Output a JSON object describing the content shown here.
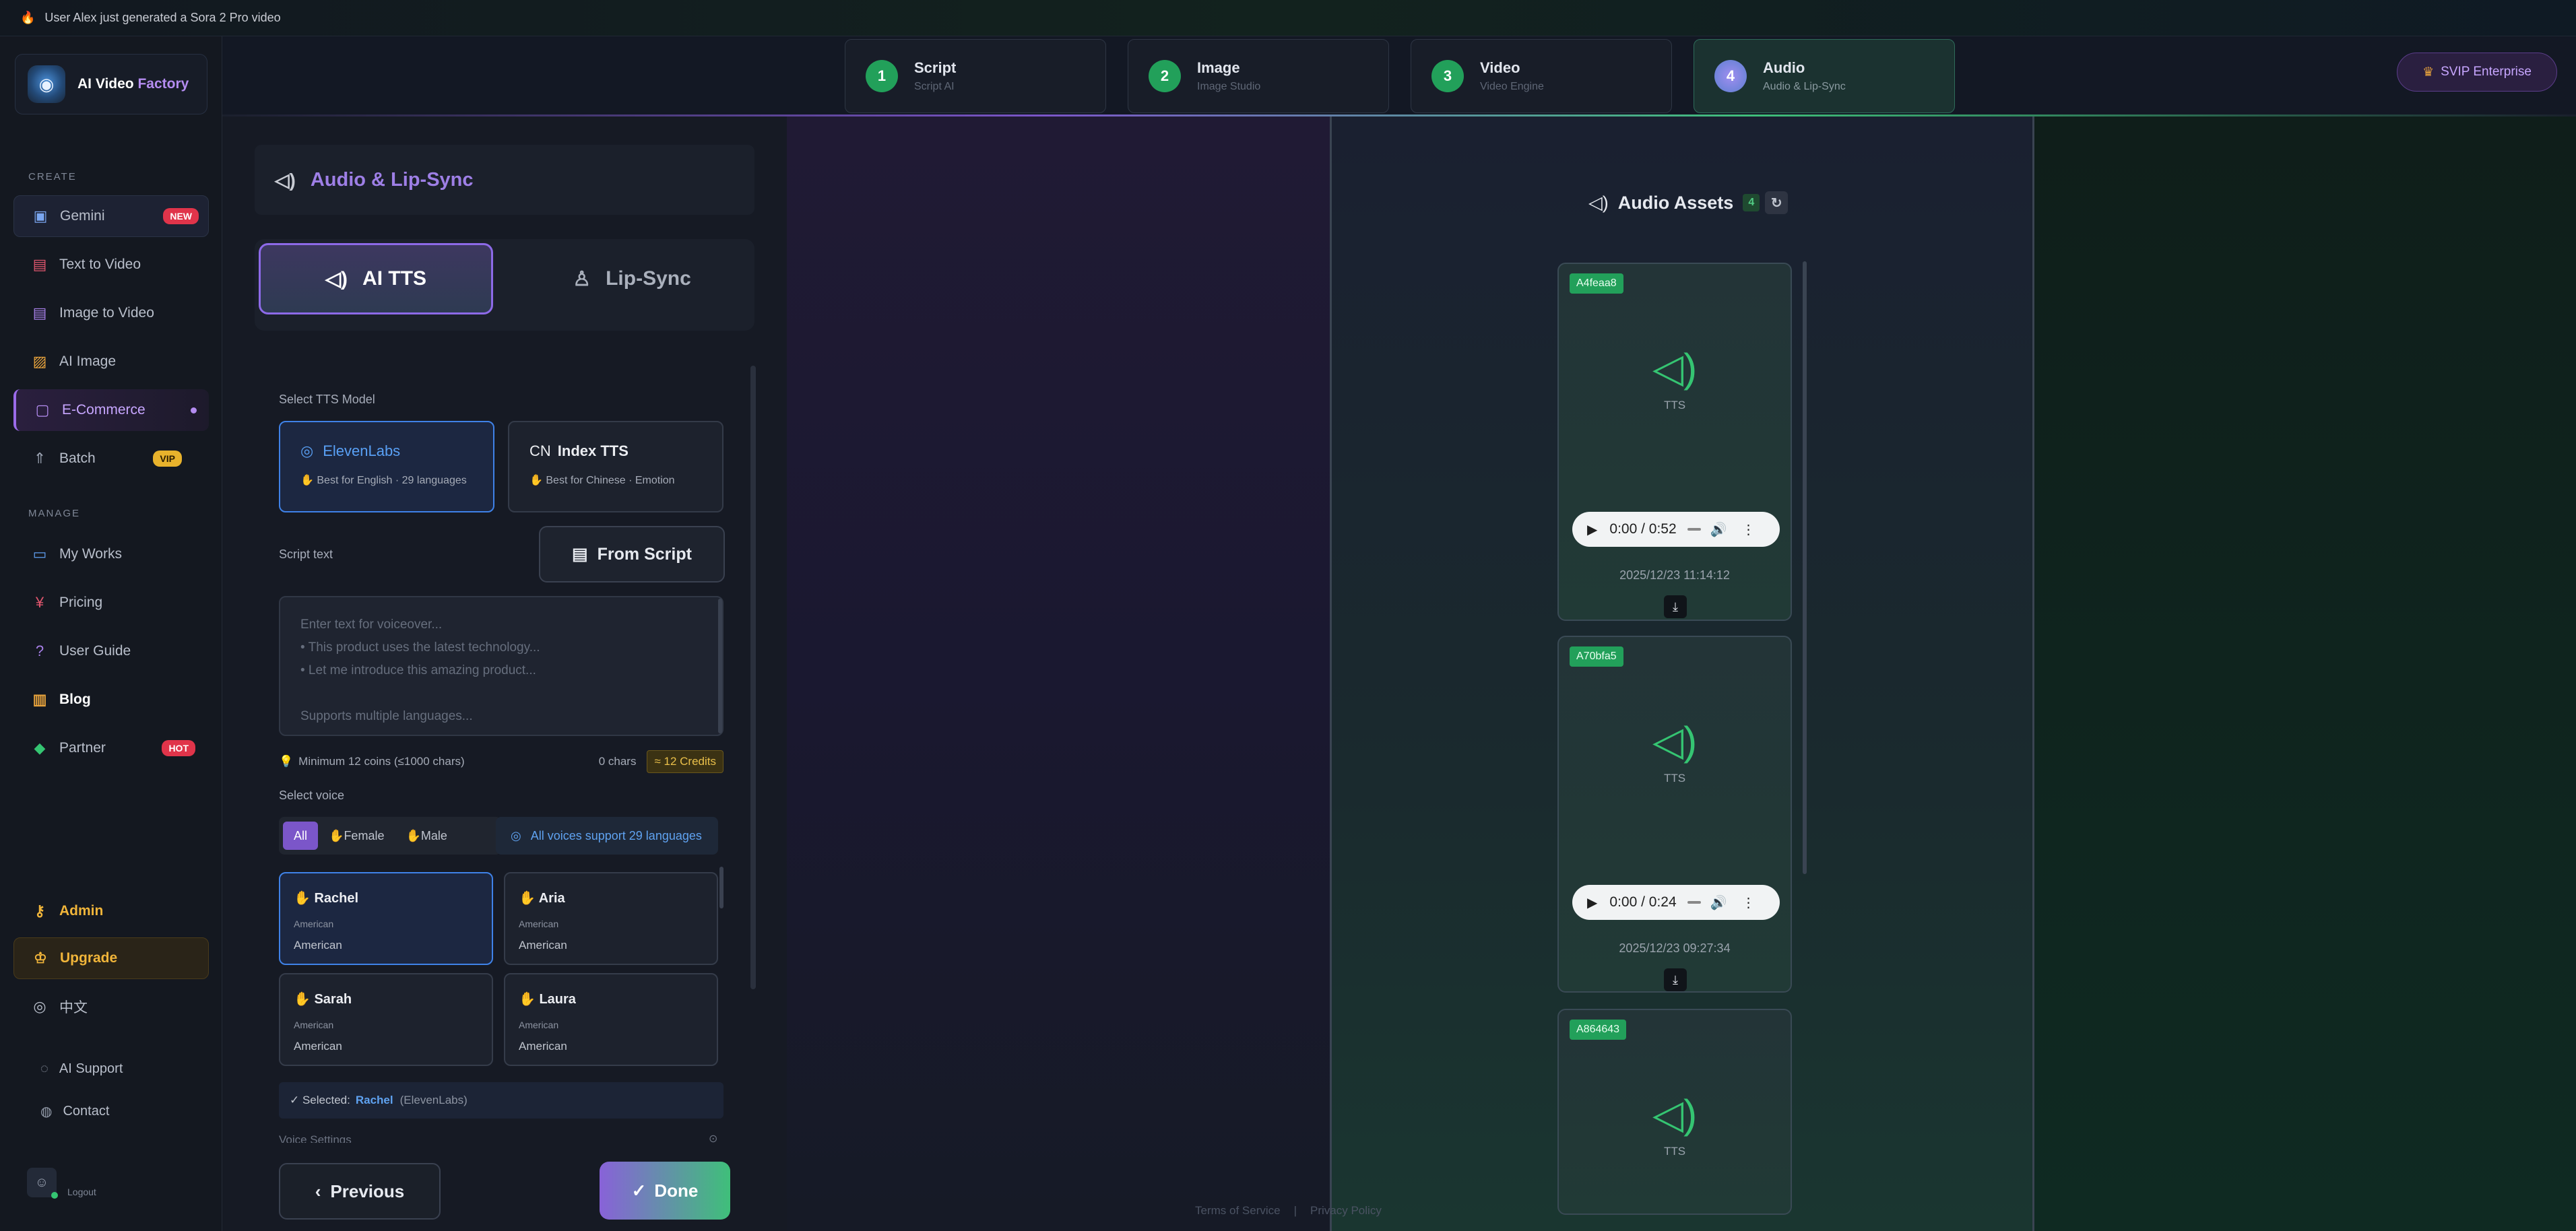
{
  "ticker": {
    "text": "User Alex just generated a Sora 2 Pro video"
  },
  "app": {
    "name_main": "AI Video",
    "name_accent": "Factory"
  },
  "sidebar": {
    "create_label": "CREATE",
    "manage_label": "MANAGE",
    "create_items": [
      {
        "label": "Gemini",
        "icon": "gemini-icon",
        "badge": "NEW"
      },
      {
        "label": "Text to Video",
        "icon": "document-icon"
      },
      {
        "label": "Image to Video",
        "icon": "image-doc-icon"
      },
      {
        "label": "AI Image",
        "icon": "image-icon"
      },
      {
        "label": "E-Commerce",
        "icon": "shopping-bag-icon"
      },
      {
        "label": "Batch",
        "icon": "rocket-icon",
        "badge": "VIP"
      }
    ],
    "manage_items": [
      {
        "label": "My Works",
        "icon": "folder-icon"
      },
      {
        "label": "Pricing",
        "icon": "yen-icon"
      },
      {
        "label": "User Guide",
        "icon": "help-icon"
      },
      {
        "label": "Blog",
        "icon": "book-icon"
      },
      {
        "label": "Partner",
        "icon": "diamond-icon",
        "badge": "HOT"
      }
    ],
    "bottom_items": [
      {
        "label": "Admin",
        "icon": "key-icon"
      },
      {
        "label": "Upgrade",
        "icon": "crown-icon"
      },
      {
        "label": "中文",
        "icon": "globe-icon"
      }
    ],
    "support": {
      "ai_support": "AI Support",
      "contact": "Contact"
    },
    "logout": "Logout"
  },
  "steps": [
    {
      "num": "1",
      "title": "Script",
      "subtitle": "Script AI"
    },
    {
      "num": "2",
      "title": "Image",
      "subtitle": "Image Studio"
    },
    {
      "num": "3",
      "title": "Video",
      "subtitle": "Video Engine"
    },
    {
      "num": "4",
      "title": "Audio",
      "subtitle": "Audio & Lip-Sync"
    }
  ],
  "svip": "SVIP Enterprise",
  "panel": {
    "title": "Audio & Lip-Sync",
    "modes": {
      "tts": "AI TTS",
      "lipsync": "Lip-Sync"
    },
    "select_model_label": "Select TTS Model",
    "models": [
      {
        "name": "ElevenLabs",
        "desc": "Best for English · 29 languages",
        "icon": "globe-icon"
      },
      {
        "prefix": "CN",
        "name": "Index TTS",
        "desc": "Best for Chinese · Emotion"
      }
    ],
    "script_label": "Script text",
    "from_script": "From Script",
    "textarea_placeholder": "Enter text for voiceover...\n• This product uses the latest technology...\n• Let me introduce this amazing product...\n\nSupports multiple languages...",
    "min_coins": "Minimum 12 coins (≤1000 chars)",
    "chars": "0 chars",
    "credits": "≈ 12 Credits",
    "select_voice_label": "Select voice",
    "voice_filters": [
      "All",
      "Female",
      "Male"
    ],
    "lang_note": "All voices support 29 languages",
    "voices": [
      {
        "name": "Rachel",
        "accent": "American",
        "lang": "American"
      },
      {
        "name": "Aria",
        "accent": "American",
        "lang": "American"
      },
      {
        "name": "Sarah",
        "accent": "American",
        "lang": "American"
      },
      {
        "name": "Laura",
        "accent": "American",
        "lang": "American"
      }
    ],
    "selected_prefix": "✓ Selected:",
    "selected_voice": "Rachel",
    "selected_provider": "(ElevenLabs)",
    "voice_settings": "Voice Settings",
    "previous": "Previous",
    "done": "Done"
  },
  "assets": {
    "title": "Audio Assets",
    "count": "4",
    "items": [
      {
        "id": "A4feaa8",
        "type": "TTS",
        "time": "0:00 / 0:52",
        "date": "2025/12/23 11:14:12"
      },
      {
        "id": "A70bfa5",
        "type": "TTS",
        "time": "0:00 / 0:24",
        "date": "2025/12/23 09:27:34"
      },
      {
        "id": "A864643",
        "type": "TTS"
      }
    ]
  },
  "footer": {
    "terms": "Terms of Service",
    "sep": "|",
    "privacy": "Privacy Policy"
  }
}
